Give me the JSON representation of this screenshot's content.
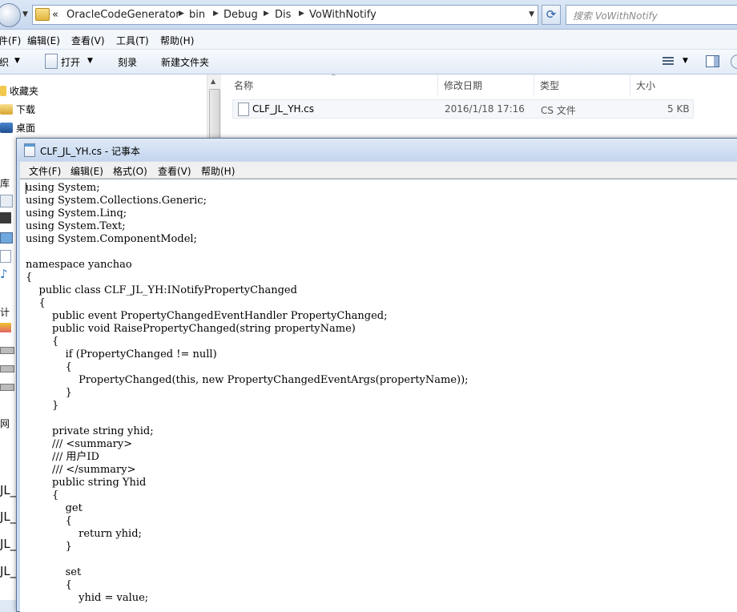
{
  "explorer": {
    "breadcrumb": [
      "OracleCodeGenerator",
      "bin",
      "Debug",
      "Dis",
      "VoWithNotify"
    ],
    "breadcrumb_prefix": "«",
    "search_placeholder": "搜索 VoWithNotify",
    "menu": [
      "件(F)",
      "编辑(E)",
      "查看(V)",
      "工具(T)",
      "帮助(H)"
    ],
    "toolbar": {
      "organize": "织",
      "open": "打开",
      "burn": "刻录",
      "new_folder": "新建文件夹"
    },
    "nav": [
      "收藏夹",
      "下载",
      "桌面"
    ],
    "columns": {
      "name": "名称",
      "date": "修改日期",
      "type": "类型",
      "size": "大小"
    },
    "files": [
      {
        "name": "CLF_JL_YH.cs",
        "date": "2016/1/18 17:16",
        "type": "CS 文件",
        "size": "5 KB"
      }
    ],
    "left_strip_labels": [
      "库",
      "计",
      "网",
      "JL_",
      "JL_",
      "JL_",
      "JL_"
    ]
  },
  "notepad": {
    "title": "CLF_JL_YH.cs - 记事本",
    "menu": [
      "文件(F)",
      "编辑(E)",
      "格式(O)",
      "查看(V)",
      "帮助(H)"
    ],
    "code_lines": [
      "using System;",
      "using System.Collections.Generic;",
      "using System.Linq;",
      "using System.Text;",
      "using System.ComponentModel;",
      "",
      "namespace yanchao",
      "{",
      "    public class CLF_JL_YH:INotifyPropertyChanged",
      "    {",
      "        public event PropertyChangedEventHandler PropertyChanged;",
      "        public void RaisePropertyChanged(string propertyName)",
      "        {",
      "            if (PropertyChanged != null)",
      "            {",
      "                PropertyChanged(this, new PropertyChangedEventArgs(propertyName));",
      "            }",
      "        }",
      "",
      "        private string yhid;",
      "        /// <summary>",
      "        /// 用户ID",
      "        /// </summary>",
      "        public string Yhid",
      "        {",
      "            get",
      "            {",
      "                return yhid;",
      "            }",
      "",
      "            set",
      "            {",
      "                yhid = value;"
    ]
  },
  "colors": {
    "title_bar": "#c4d6ee",
    "window_border": "#5d7497",
    "link_blue": "#2a5ea8"
  }
}
